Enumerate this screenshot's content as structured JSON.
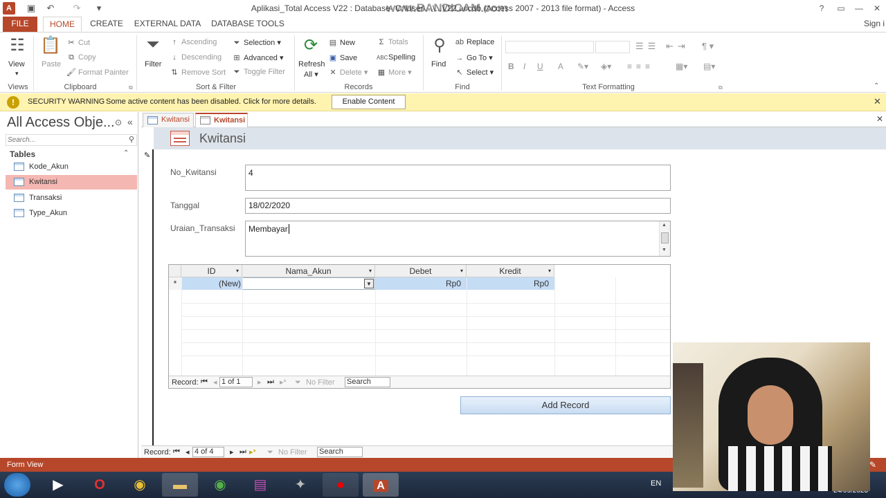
{
  "window": {
    "title": "Aplikasi_Total Access V22 : Database- C:\\User\\...\\...V22.accdb (Access 2007 - 2013 file format) - Access",
    "help": "?",
    "sign_in": "Sign i",
    "watermark": "www.BANDICAM.com"
  },
  "ribbon_tabs": [
    "FILE",
    "HOME",
    "CREATE",
    "EXTERNAL DATA",
    "DATABASE TOOLS"
  ],
  "ribbon": {
    "views": {
      "view": "View",
      "label": "Views"
    },
    "clipboard": {
      "paste": "Paste",
      "cut": "Cut",
      "copy": "Copy",
      "format_painter": "Format Painter",
      "label": "Clipboard"
    },
    "sort_filter": {
      "filter": "Filter",
      "ascending": "Ascending",
      "descending": "Descending",
      "remove_sort": "Remove Sort",
      "selection": "Selection",
      "advanced": "Advanced",
      "toggle_filter": "Toggle Filter",
      "label": "Sort & Filter"
    },
    "records": {
      "refresh": "Refresh",
      "refresh_all": "All",
      "new": "New",
      "save": "Save",
      "delete": "Delete",
      "totals": "Totals",
      "spelling": "Spelling",
      "more": "More",
      "label": "Records"
    },
    "find": {
      "find": "Find",
      "replace": "Replace",
      "goto": "Go To",
      "select": "Select",
      "label": "Find"
    },
    "text_formatting": {
      "bold": "B",
      "italic": "I",
      "underline": "U",
      "font_color": "A",
      "label": "Text Formatting"
    }
  },
  "security": {
    "title": "SECURITY WARNING",
    "message": "Some active content has been disabled. Click for more details.",
    "button": "Enable Content"
  },
  "nav": {
    "title": "All Access Obje...",
    "search_placeholder": "Search...",
    "section": "Tables",
    "items": [
      "Kode_Akun",
      "Kwitansi",
      "Transaksi",
      "Type_Akun"
    ],
    "selected": "Kwitansi"
  },
  "doc_tabs": [
    "Kwitansi",
    "Kwitansi"
  ],
  "form": {
    "title": "Kwitansi",
    "fields": {
      "no_kwitansi_label": "No_Kwitansi",
      "no_kwitansi_value": "4",
      "tanggal_label": "Tanggal",
      "tanggal_value": "18/02/2020",
      "uraian_label": "Uraian_Transaksi",
      "uraian_value": "Membayar"
    },
    "subform": {
      "columns": [
        "ID",
        "Nama_Akun",
        "Debet",
        "Kredit"
      ],
      "new_row": {
        "marker": "*",
        "id": "(New)",
        "nama_akun": "",
        "debet": "Rp0",
        "kredit": "Rp0"
      },
      "nav": {
        "record_label": "Record:",
        "position": "1 of 1",
        "filter": "No Filter",
        "search": "Search"
      }
    },
    "add_record": "Add Record",
    "nav": {
      "record_label": "Record:",
      "position": "4 of 4",
      "filter": "No Filter",
      "search": "Search"
    }
  },
  "status": {
    "view": "Form View"
  },
  "taskbar": {
    "lang": "EN",
    "date": "24/09/2023"
  }
}
